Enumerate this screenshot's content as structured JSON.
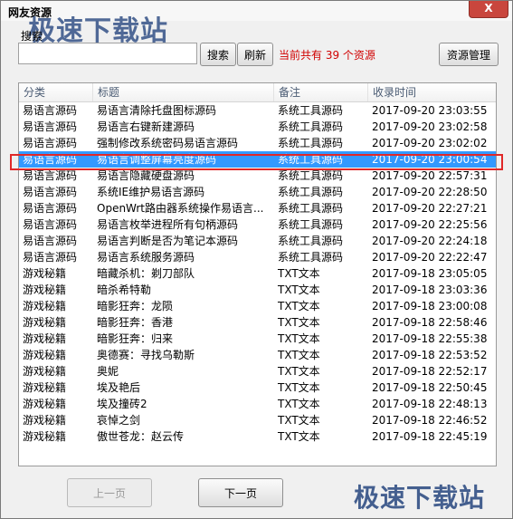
{
  "window": {
    "title": "网友资源",
    "close_label": "X"
  },
  "watermark": {
    "text": "极速下载站"
  },
  "search": {
    "label": "搜索",
    "placeholder": "",
    "value": ""
  },
  "toolbar": {
    "search_label": "搜索",
    "refresh_label": "刷新",
    "status_text": "当前共有 39 个资源",
    "manage_label": "资源管理"
  },
  "table": {
    "columns": [
      "分类",
      "标题",
      "备注",
      "收录时间"
    ],
    "rows": [
      [
        "易语言源码",
        "易语言清除托盘图标源码",
        "系统工具源码",
        "2017-09-20 23:03:55"
      ],
      [
        "易语言源码",
        "易语言右键新建源码",
        "系统工具源码",
        "2017-09-20 23:02:58"
      ],
      [
        "易语言源码",
        " 强制修改系统密码易语言源码",
        "系统工具源码",
        "2017-09-20 23:02:02"
      ],
      [
        "易语言源码",
        "易语言调整屏幕亮度源码",
        "系统工具源码",
        "2017-09-20 23:00:54"
      ],
      [
        "易语言源码",
        "易语言隐藏硬盘源码",
        "系统工具源码",
        "2017-09-20 22:57:31"
      ],
      [
        "易语言源码",
        "系统IE维护易语言源码",
        "系统工具源码",
        "2017-09-20 22:28:50"
      ],
      [
        "易语言源码",
        "OpenWrt路由器系统操作易语言...",
        "系统工具源码",
        "2017-09-20 22:27:21"
      ],
      [
        "易语言源码",
        "易语言枚举进程所有句柄源码",
        "系统工具源码",
        "2017-09-20 22:25:56"
      ],
      [
        "易语言源码",
        "易语言判断是否为笔记本源码",
        "系统工具源码",
        "2017-09-20 22:24:18"
      ],
      [
        "易语言源码",
        "易语言系统服务源码",
        "系统工具源码",
        "2017-09-20 22:22:47"
      ],
      [
        "游戏秘籍",
        "暗藏杀机：剃刀部队",
        "TXT文本",
        "2017-09-18 23:05:05"
      ],
      [
        "游戏秘籍",
        "暗杀希特勒",
        "TXT文本",
        "2017-09-18 23:03:36"
      ],
      [
        "游戏秘籍",
        "暗影狂奔：龙陨",
        "TXT文本",
        "2017-09-18 23:00:08"
      ],
      [
        "游戏秘籍",
        "暗影狂奔：香港",
        "TXT文本",
        "2017-09-18 22:58:46"
      ],
      [
        "游戏秘籍",
        "暗影狂奔：归来",
        "TXT文本",
        "2017-09-18 22:55:38"
      ],
      [
        "游戏秘籍",
        "奥德赛：寻找乌勒斯",
        "TXT文本",
        "2017-09-18 22:53:52"
      ],
      [
        "游戏秘籍",
        "奥妮",
        "TXT文本",
        "2017-09-18 22:52:17"
      ],
      [
        "游戏秘籍",
        "埃及艳后",
        "TXT文本",
        "2017-09-18 22:50:45"
      ],
      [
        "游戏秘籍",
        "埃及撞砖2",
        "TXT文本",
        "2017-09-18 22:48:13"
      ],
      [
        "游戏秘籍",
        "哀悼之剑",
        "TXT文本",
        "2017-09-18 22:46:52"
      ],
      [
        "游戏秘籍",
        "傲世苍龙：赵云传",
        "TXT文本",
        "2017-09-18 22:45:19"
      ]
    ],
    "selected_index": 3
  },
  "pager": {
    "prev_label": "上一页",
    "next_label": "下一页"
  },
  "colors": {
    "selection": "#3399ff",
    "status": "#d00000",
    "highlight_border": "#e02828"
  }
}
